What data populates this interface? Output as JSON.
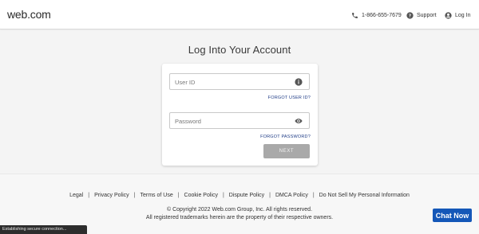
{
  "header": {
    "logo": "web.com",
    "phone": "1-866-655-7679",
    "support": "Support",
    "login": "Log In",
    "icons": {
      "phone": "phone-icon",
      "support": "help-circle-icon",
      "login": "user-circle-icon"
    }
  },
  "main": {
    "title": "Log Into Your Account",
    "user_id_placeholder": "User ID",
    "forgot_user_id": "FORGOT USER ID?",
    "password_placeholder": "Password",
    "forgot_password": "FORGOT PASSWORD?",
    "next_label": "NEXT",
    "icons": {
      "user_id": "info-icon",
      "password": "eye-icon"
    }
  },
  "footer": {
    "links": [
      "Legal",
      "Privacy Policy",
      "Terms of Use",
      "Cookie Policy",
      "Dispute Policy",
      "DMCA Policy",
      "Do Not Sell My Personal Information"
    ],
    "separator": "|",
    "copyright": "© Copyright 2022 Web.com Group, Inc. All rights reserved.",
    "trademarks": "All registered trademarks herein are the property of their respective owners."
  },
  "status_bar": {
    "text": "Establishing secure connection..."
  },
  "chat": {
    "label": "Chat Now"
  },
  "colors": {
    "link": "#1f3c86",
    "next_disabled": "#a9a9a9",
    "chat_button": "#1457b8",
    "status_bar": "#2d2d2d"
  }
}
